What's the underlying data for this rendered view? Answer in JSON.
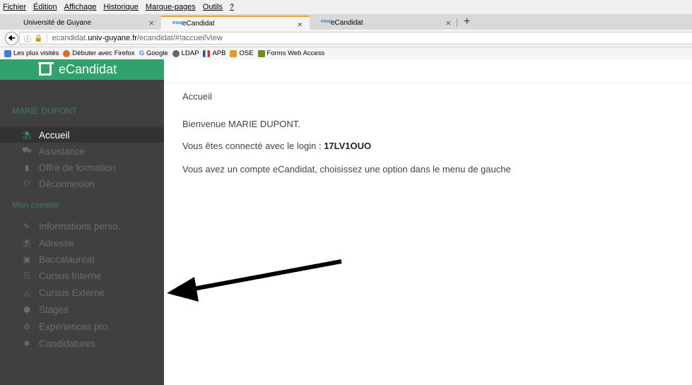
{
  "menu": [
    "Fichier",
    "Édition",
    "Affichage",
    "Historique",
    "Marque-pages",
    "Outils",
    "?"
  ],
  "tabs": [
    {
      "label": "Université de Guyane",
      "icon": "page-icon"
    },
    {
      "label": "eCandidat",
      "icon": "esup-icon"
    },
    {
      "label": "eCandidat",
      "icon": "esup-icon"
    }
  ],
  "esup_badge": "esup",
  "nav": {
    "url_prefix": "ecandidat.",
    "url_domain": "univ-guyane.fr",
    "url_path": "/ecandidat/#!accueilView"
  },
  "bookmarks": [
    {
      "label": "Les plus visités",
      "color": "#3b7dd8"
    },
    {
      "label": "Débuter avec Firefox",
      "color": "#e8662b"
    },
    {
      "label": "Google",
      "color": "#4285f4"
    },
    {
      "label": "LDAP",
      "color": "#666666"
    },
    {
      "label": "APB",
      "color": "#d0302e"
    },
    {
      "label": "OSE",
      "color": "#e0a020"
    },
    {
      "label": "Forms Web Access",
      "color": "#6b8e23"
    }
  ],
  "sidebar": {
    "brand": "eCandidat",
    "user_name": "MARIE DUPONT",
    "items_top": [
      {
        "label": "Accueil",
        "icon": "home-icon",
        "active": true
      },
      {
        "label": "Assistance",
        "icon": "truck-icon"
      },
      {
        "label": "Offre de formation",
        "icon": "bookmark-icon"
      },
      {
        "label": "Déconnexion",
        "icon": "power-icon"
      }
    ],
    "section_account": "Mon compte",
    "items_account": [
      {
        "label": "Informations perso.",
        "icon": "pencil-icon"
      },
      {
        "label": "Adresse",
        "icon": "home-icon"
      },
      {
        "label": "Baccalauréat",
        "icon": "book-icon"
      },
      {
        "label": "Cursus Interne",
        "icon": "institution-icon"
      },
      {
        "label": "Cursus Externe",
        "icon": "graduation-cap-icon"
      },
      {
        "label": "Stages",
        "icon": "cube-icon"
      },
      {
        "label": "Expériences pro.",
        "icon": "cogs-icon"
      },
      {
        "label": "Candidatures",
        "icon": "asterisk-icon"
      }
    ]
  },
  "main": {
    "title": "Accueil",
    "welcome": "Bienvenue MARIE DUPONT.",
    "login_text": "Vous êtes connecté avec le login : ",
    "login_value": "17LV1OUO",
    "info": "Vous avez un compte eCandidat, choisissez une option dans le menu de gauche"
  },
  "colors": {
    "accent": "#2fa36b",
    "sidebar_bg": "#404040",
    "tab_highlight": "#e8a33d"
  }
}
